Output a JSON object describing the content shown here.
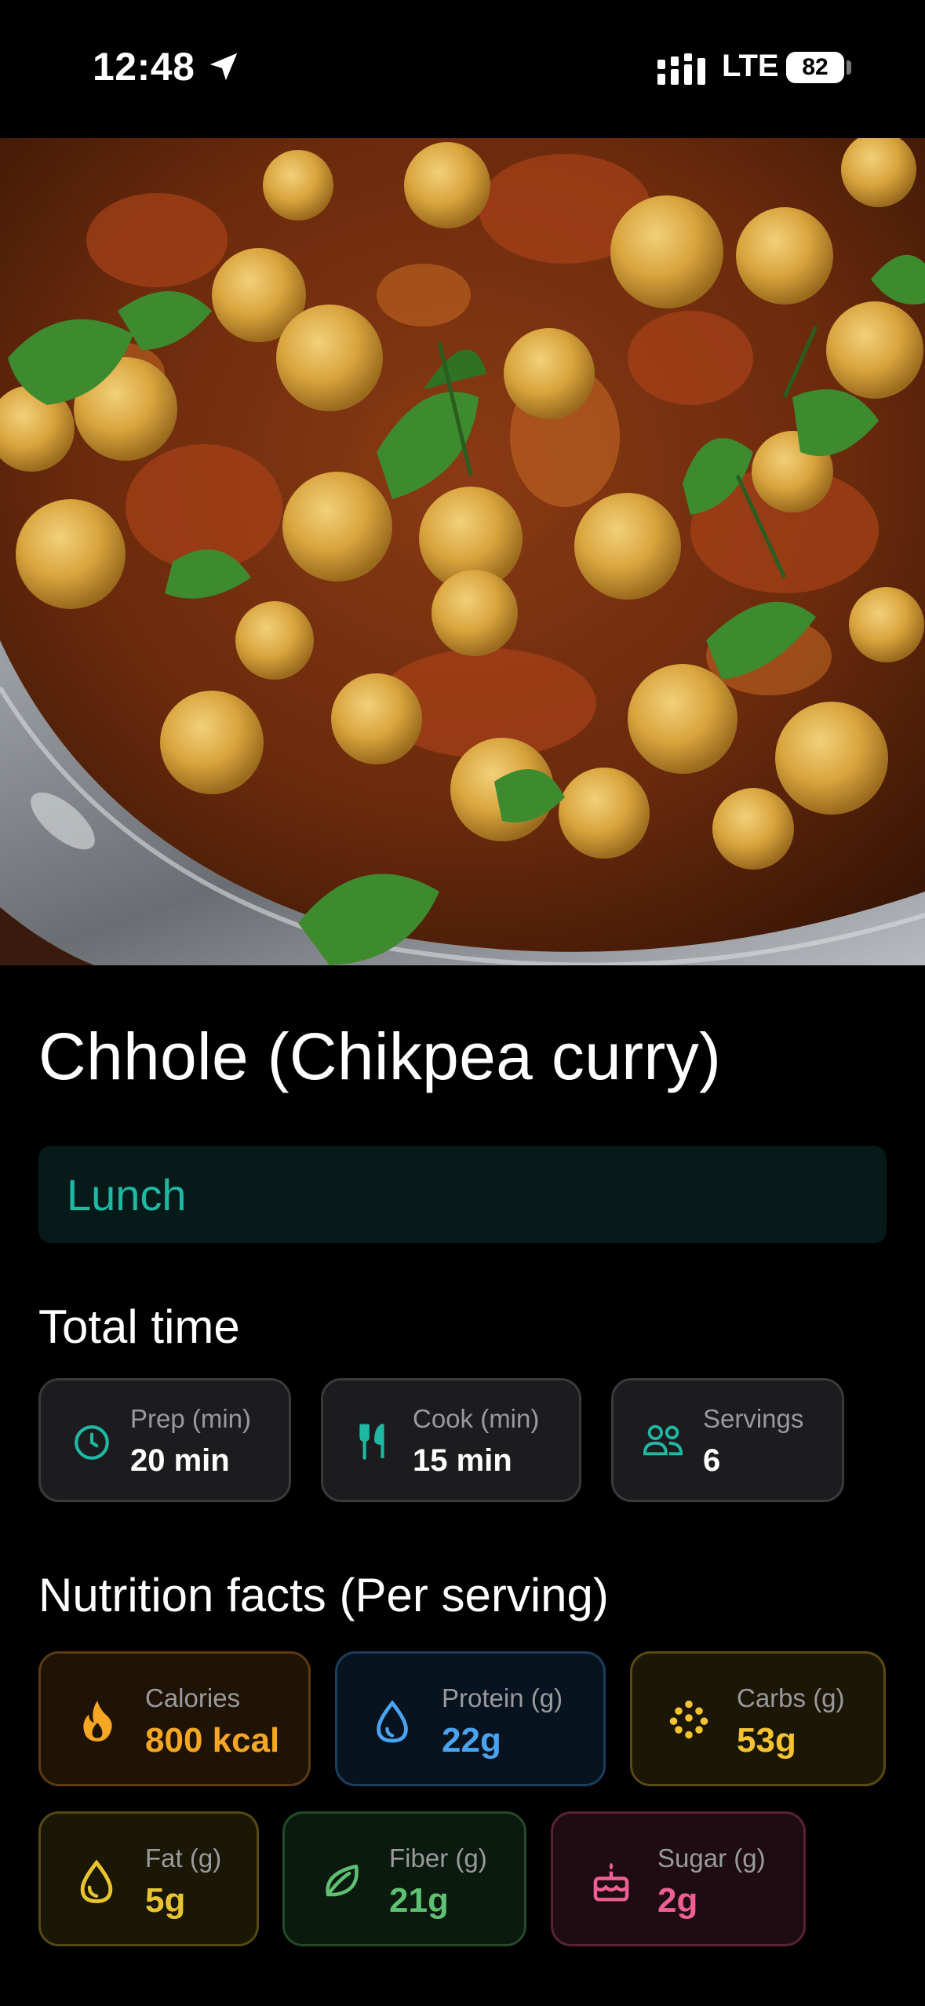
{
  "status_bar": {
    "time": "12:48",
    "network": "LTE",
    "battery": "82",
    "icons": [
      "location-arrow-icon",
      "signal-icon",
      "battery-icon"
    ]
  },
  "recipe": {
    "hero_image": "chickpea-curry-photo",
    "title": "Chhole (Chikpea curry)",
    "meal_type": "Lunch"
  },
  "total_time": {
    "heading": "Total time",
    "items": [
      {
        "label": "Prep (min)",
        "value": "20 min",
        "icon": "clock-icon"
      },
      {
        "label": "Cook (min)",
        "value": "15 min",
        "icon": "utensils-icon"
      },
      {
        "label": "Servings",
        "value": "6",
        "icon": "people-icon"
      }
    ]
  },
  "nutrition": {
    "heading": "Nutrition facts (Per serving)",
    "items": [
      {
        "label": "Calories",
        "value": "800 kcal",
        "icon": "flame-icon",
        "color": "#f5a623"
      },
      {
        "label": "Protein (g)",
        "value": "22g",
        "icon": "droplet-icon",
        "color": "#4aa3f0"
      },
      {
        "label": "Carbs (g)",
        "value": "53g",
        "icon": "grains-icon",
        "color": "#f4c430"
      },
      {
        "label": "Fat (g)",
        "value": "5g",
        "icon": "oil-drop-icon",
        "color": "#e8c431"
      },
      {
        "label": "Fiber (g)",
        "value": "21g",
        "icon": "leaf-icon",
        "color": "#5fbf72"
      },
      {
        "label": "Sugar (g)",
        "value": "2g",
        "icon": "cake-icon",
        "color": "#ef5f93"
      }
    ]
  },
  "colors": {
    "accent": "#1fb8a3",
    "background": "#000000",
    "card": "#1c1c1e"
  }
}
